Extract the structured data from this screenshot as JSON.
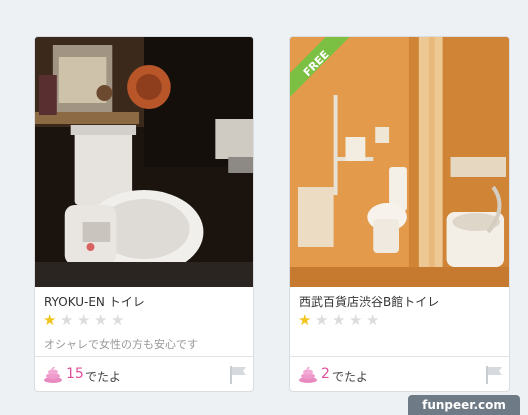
{
  "cards": [
    {
      "title": "RYOKU-EN トイレ",
      "rating": 1,
      "rating_max": 5,
      "description": "オシャレで女性の方も安心です",
      "count": "15",
      "count_unit": "でたよ"
    },
    {
      "title": "西武百貨店渋谷B館トイレ",
      "rating": 1,
      "rating_max": 5,
      "description": "",
      "count": "2",
      "count_unit": "でたよ",
      "ribbon": "FREE"
    }
  ],
  "watermark": "funpeer.com",
  "colors": {
    "count": "#e0509a",
    "star_on": "#f2c41d",
    "star_off": "#dcdcdc",
    "ribbon": "#7bc043"
  }
}
